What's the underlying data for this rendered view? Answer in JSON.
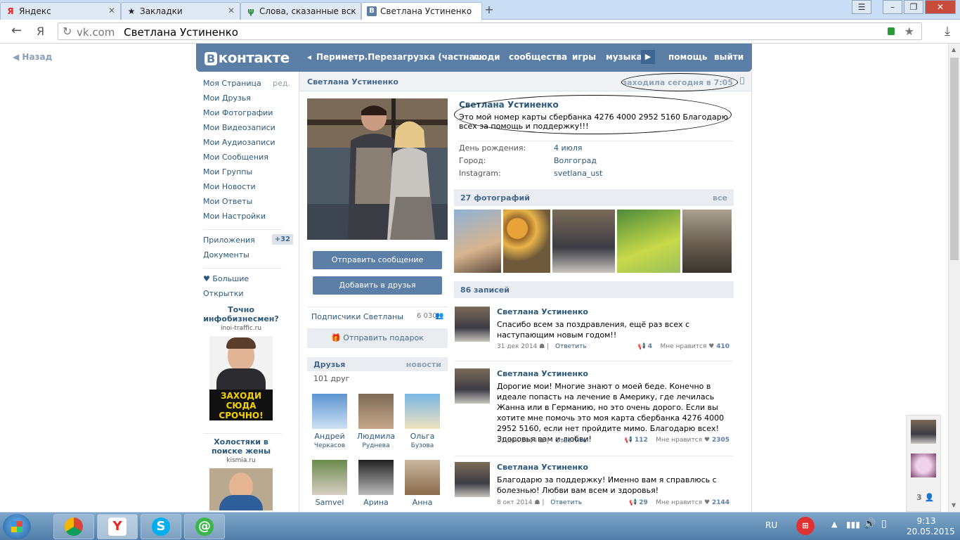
{
  "browser": {
    "tabs": [
      {
        "label": "Яндекс",
        "icon": "Я"
      },
      {
        "label": "Закладки",
        "icon": "★"
      },
      {
        "label": "Слова, сказанные вск",
        "icon": "ψ"
      },
      {
        "label": "Светлана Устиненко",
        "icon": "В"
      }
    ],
    "address_domain": "vk.com",
    "address_title": "Светлана Устиненко",
    "address_prefix": "Я"
  },
  "back_label": "Назад",
  "header": {
    "logo": "контакте",
    "logo_mark": "В",
    "nav_current": "Периметр.Перезагрузка (частна...",
    "nav": [
      "люди",
      "сообщества",
      "игры",
      "музыка",
      "помощь",
      "выйти"
    ]
  },
  "left_menu": {
    "items": [
      "Моя Страница",
      "Мои Друзья",
      "Мои Фотографии",
      "Мои Видеозаписи",
      "Мои Аудиозаписи",
      "Мои Сообщения",
      "Мои Группы",
      "Мои Новости",
      "Мои Ответы",
      "Мои Настройки"
    ],
    "edit_label": "ред.",
    "apps_label": "Приложения",
    "apps_badge": "+32",
    "docs_label": "Документы",
    "more_label": "♥ Большие",
    "cards_label": "Открытки"
  },
  "ads": [
    {
      "title": "Точно инфобизнесмен?",
      "url": "inoi-traffic.ru",
      "banner": "ЗАХОДИ СЮДА СРОЧНО!"
    },
    {
      "title": "Холостяки в поиске жены",
      "url": "kismia.ru"
    }
  ],
  "profile": {
    "header_name": "Светлана Устиненко",
    "online": "заходила сегодня в 7:05",
    "name": "Светлана Устиненко",
    "status": "Это мой номер карты сбербанка 4276 4000 2952 5160 Благодарю всех за помощь и поддержку!!!",
    "info": [
      {
        "key": "День рождения:",
        "value": "4 июля"
      },
      {
        "key": "Город:",
        "value": "Волгоград"
      },
      {
        "key": "Instagram:",
        "value": "svetlana_ust"
      }
    ],
    "send_message": "Отправить сообщение",
    "add_friend": "Добавить в друзья",
    "subscribers_label": "Подписчики Светланы",
    "subscribers_count": "6 030",
    "gift_label": "Отправить подарок",
    "friends_title": "Друзья",
    "friends_news": "новости",
    "friends_count": "101 друг",
    "friends": [
      {
        "first": "Андрей",
        "last": "Черкасов"
      },
      {
        "first": "Людмила",
        "last": "Руднева"
      },
      {
        "first": "Ольга",
        "last": "Бузова"
      },
      {
        "first": "Samvel",
        "last": ""
      },
      {
        "first": "Арина",
        "last": ""
      },
      {
        "first": "Анна",
        "last": ""
      }
    ],
    "photos_title": "27 фотографий",
    "photos_all": "все",
    "posts_title": "86 записей"
  },
  "posts": [
    {
      "author": "Светлана Устиненко",
      "text": "Спасибо всем за поздравления, ещё раз всех с наступающим новым годом!!",
      "date": "31 дек 2014",
      "reply": "Ответить",
      "reposts": "4",
      "like_label": "Мне нравится",
      "likes": "410"
    },
    {
      "author": "Светлана Устиненко",
      "text": "Дорогие мои! Многие знают о моей беде. Конечно в идеале попасть на лечение в Америку, где лечилась Жанна или в Германию, но это очень дорого. Если вы хотите мне помочь это моя карта сбербанка 4276 4000 2952 5160, если нет пройдите мимо. Благодарю всех! Здоровья вам и любви!",
      "date": "11 дек 2014",
      "reply": "Ответить",
      "reposts": "112",
      "like_label": "Мне нравится",
      "likes": "2305"
    },
    {
      "author": "Светлана Устиненко",
      "text": "Благодарю за поддержку! Именно вам я справлюсь с болезнью! Любви вам всем и здоровья!",
      "date": "8 окт 2014",
      "reply": "Ответить",
      "reposts": "29",
      "like_label": "Мне нравится",
      "likes": "2144"
    }
  ],
  "right_panel": {
    "count": "3"
  },
  "taskbar": {
    "lang": "RU",
    "time": "9:13",
    "date": "20.05.2015"
  }
}
